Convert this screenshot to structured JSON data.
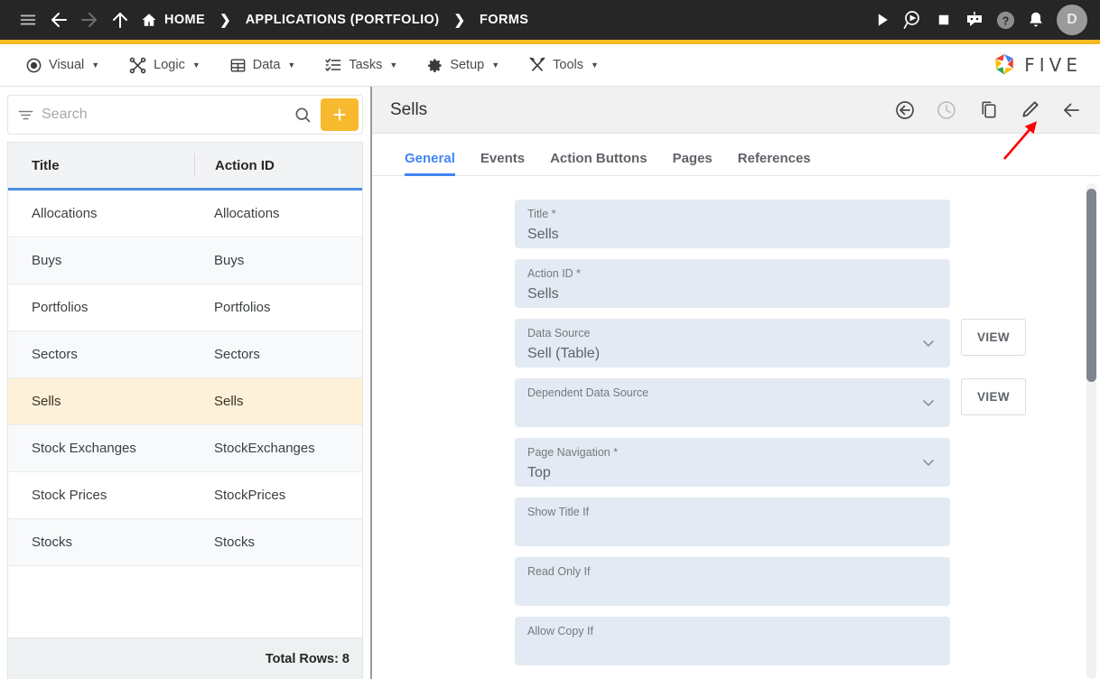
{
  "topbar": {
    "menu_icon": "hamburger-icon",
    "back_icon": "arrow-left-icon",
    "forward_icon": "arrow-right-icon",
    "up_icon": "arrow-up-icon",
    "breadcrumbs": [
      {
        "label": "HOME",
        "icon": "home-icon"
      },
      {
        "label": "APPLICATIONS (PORTFOLIO)",
        "icon": ""
      },
      {
        "label": "FORMS",
        "icon": ""
      }
    ],
    "separator": "❯",
    "actions": [
      {
        "name": "run-icon",
        "title": "Run"
      },
      {
        "name": "debug-icon",
        "title": "Debug"
      },
      {
        "name": "stop-icon",
        "title": "Stop"
      },
      {
        "name": "chatbot-icon",
        "title": "Assistant"
      },
      {
        "name": "help-icon",
        "title": "Help"
      },
      {
        "name": "notifications-bell-icon",
        "title": "Notifications"
      }
    ],
    "avatar_initial": "D"
  },
  "menubar": {
    "items": [
      {
        "label": "Visual",
        "icon": "eye-icon",
        "caret": "▼"
      },
      {
        "label": "Logic",
        "icon": "logic-nodes-icon",
        "caret": "▼"
      },
      {
        "label": "Data",
        "icon": "table-grid-icon",
        "caret": "▼"
      },
      {
        "label": "Tasks",
        "icon": "checklist-icon",
        "caret": "▼"
      },
      {
        "label": "Setup",
        "icon": "gear-icon",
        "caret": "▼"
      },
      {
        "label": "Tools",
        "icon": "tools-icon",
        "caret": "▼"
      }
    ],
    "brand": {
      "word": "FIVE",
      "logo": "five-pinwheel-logo"
    },
    "accent_color": "#f5b921"
  },
  "sidebar": {
    "search": {
      "placeholder": "Search",
      "value": "",
      "filter_icon": "filter-icon",
      "search_icon": "search-icon"
    },
    "add_button_label": "+",
    "columns": [
      "Title",
      "Action ID"
    ],
    "rows": [
      {
        "title": "Allocations",
        "action_id": "Allocations",
        "selected": false
      },
      {
        "title": "Buys",
        "action_id": "Buys",
        "selected": false
      },
      {
        "title": "Portfolios",
        "action_id": "Portfolios",
        "selected": false
      },
      {
        "title": "Sectors",
        "action_id": "Sectors",
        "selected": false
      },
      {
        "title": "Sells",
        "action_id": "Sells",
        "selected": true
      },
      {
        "title": "Stock Exchanges",
        "action_id": "StockExchanges",
        "selected": false
      },
      {
        "title": "Stock Prices",
        "action_id": "StockPrices",
        "selected": false
      },
      {
        "title": "Stocks",
        "action_id": "Stocks",
        "selected": false
      }
    ],
    "footer": {
      "total_rows_label": "Total Rows: 8"
    },
    "selection_color": "#fdf1d9",
    "header_underline_color": "#4a8fe0"
  },
  "panel": {
    "title": "Sells",
    "actions": [
      {
        "name": "revert-icon",
        "title": "Revert",
        "disabled": false
      },
      {
        "name": "history-clock-icon",
        "title": "History",
        "disabled": true
      },
      {
        "name": "copy-icon",
        "title": "Copy",
        "disabled": false
      },
      {
        "name": "edit-pencil-icon",
        "title": "Edit",
        "disabled": false
      },
      {
        "name": "back-arrow-icon",
        "title": "Back",
        "disabled": false
      }
    ],
    "tabs": [
      {
        "label": "General",
        "active": true
      },
      {
        "label": "Events",
        "active": false
      },
      {
        "label": "Action Buttons",
        "active": false
      },
      {
        "label": "Pages",
        "active": false
      },
      {
        "label": "References",
        "active": false
      }
    ],
    "active_tab_color": "#4285f4",
    "fields": [
      {
        "label": "Title *",
        "value": "Sells",
        "type": "text",
        "view_button": ""
      },
      {
        "label": "Action ID *",
        "value": "Sells",
        "type": "text",
        "view_button": ""
      },
      {
        "label": "Data Source",
        "value": "Sell (Table)",
        "type": "select",
        "view_button": "VIEW"
      },
      {
        "label": "Dependent Data Source",
        "value": "",
        "type": "select",
        "view_button": "VIEW"
      },
      {
        "label": "Page Navigation *",
        "value": "Top",
        "type": "select",
        "view_button": ""
      },
      {
        "label": "Show Title If",
        "value": "",
        "type": "text",
        "view_button": ""
      },
      {
        "label": "Read Only If",
        "value": "",
        "type": "text",
        "view_button": ""
      },
      {
        "label": "Allow Copy If",
        "value": "",
        "type": "text",
        "view_button": ""
      }
    ]
  },
  "annotation": {
    "arrow": "red-arrow-pointing-to-edit-pencil",
    "color": "#ff0000"
  }
}
